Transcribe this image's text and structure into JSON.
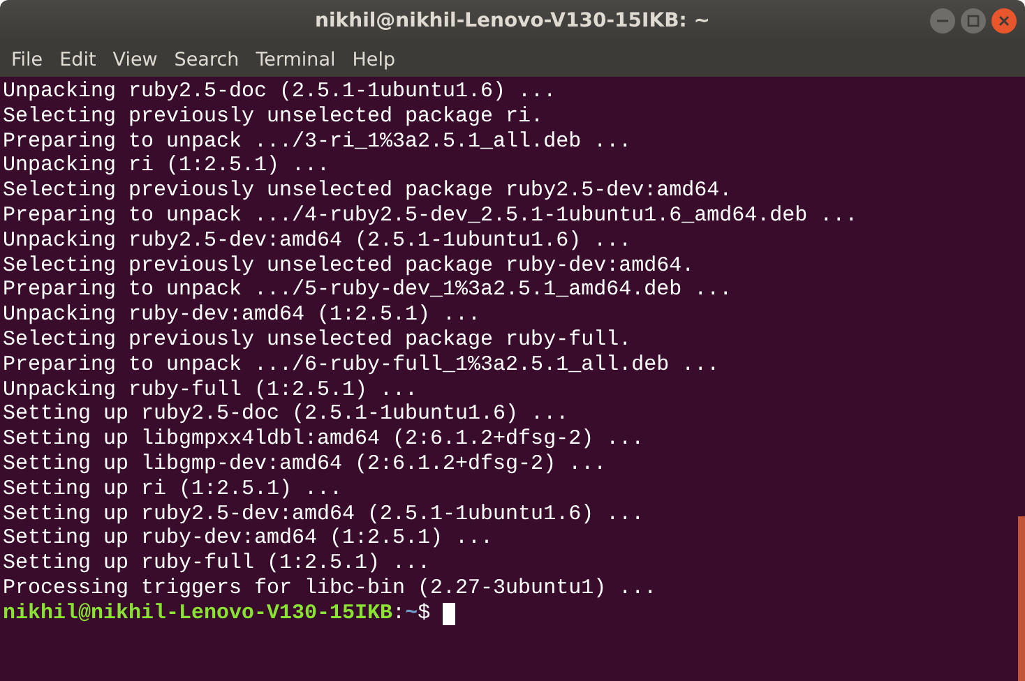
{
  "window": {
    "title": "nikhil@nikhil-Lenovo-V130-15IKB: ~"
  },
  "menu": [
    "File",
    "Edit",
    "View",
    "Search",
    "Terminal",
    "Help"
  ],
  "terminal": {
    "lines": [
      "Unpacking ruby2.5-doc (2.5.1-1ubuntu1.6) ...",
      "Selecting previously unselected package ri.",
      "Preparing to unpack .../3-ri_1%3a2.5.1_all.deb ...",
      "Unpacking ri (1:2.5.1) ...",
      "Selecting previously unselected package ruby2.5-dev:amd64.",
      "Preparing to unpack .../4-ruby2.5-dev_2.5.1-1ubuntu1.6_amd64.deb ...",
      "Unpacking ruby2.5-dev:amd64 (2.5.1-1ubuntu1.6) ...",
      "Selecting previously unselected package ruby-dev:amd64.",
      "Preparing to unpack .../5-ruby-dev_1%3a2.5.1_amd64.deb ...",
      "Unpacking ruby-dev:amd64 (1:2.5.1) ...",
      "Selecting previously unselected package ruby-full.",
      "Preparing to unpack .../6-ruby-full_1%3a2.5.1_all.deb ...",
      "Unpacking ruby-full (1:2.5.1) ...",
      "Setting up ruby2.5-doc (2.5.1-1ubuntu1.6) ...",
      "Setting up libgmpxx4ldbl:amd64 (2:6.1.2+dfsg-2) ...",
      "Setting up libgmp-dev:amd64 (2:6.1.2+dfsg-2) ...",
      "Setting up ri (1:2.5.1) ...",
      "Setting up ruby2.5-dev:amd64 (2.5.1-1ubuntu1.6) ...",
      "Setting up ruby-dev:amd64 (1:2.5.1) ...",
      "Setting up ruby-full (1:2.5.1) ...",
      "Processing triggers for libc-bin (2.27-3ubuntu1) ..."
    ],
    "prompt": {
      "user_host": "nikhil@nikhil-Lenovo-V130-15IKB",
      "separator": ":",
      "path": "~",
      "symbol": "$"
    }
  }
}
